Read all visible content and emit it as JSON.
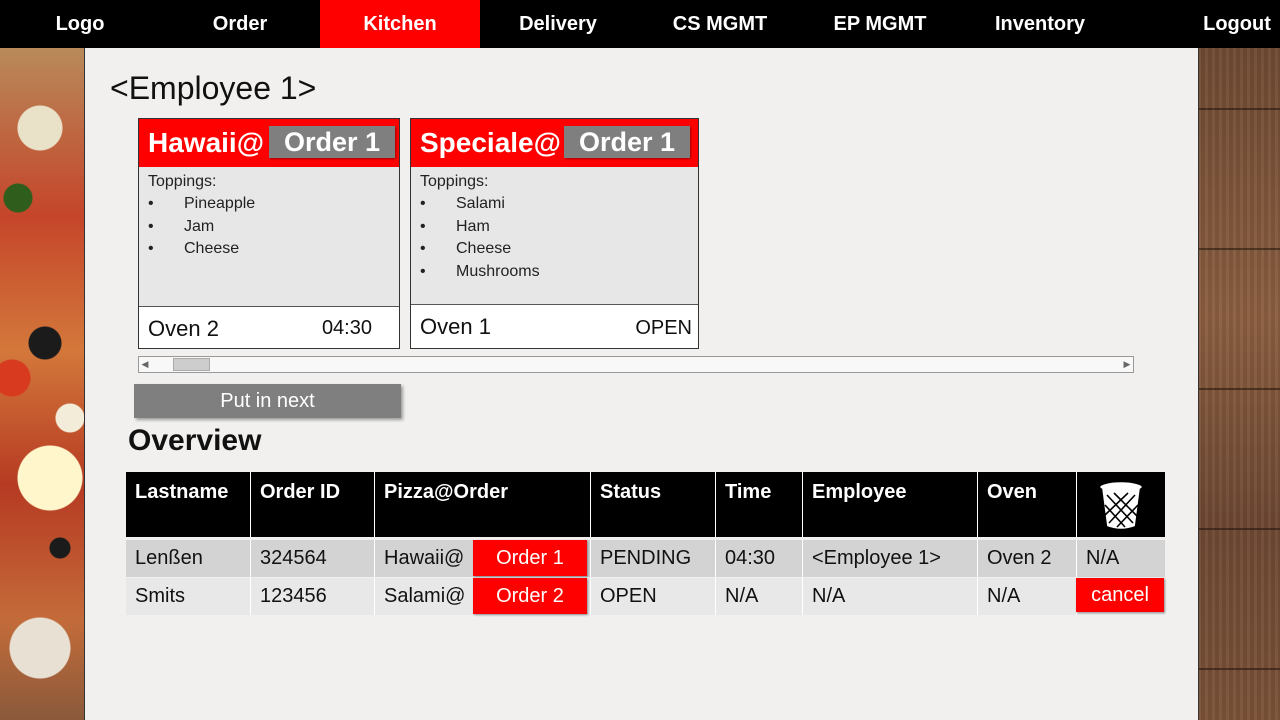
{
  "nav": {
    "items": [
      "Logo",
      "Order",
      "Kitchen",
      "Delivery",
      "CS MGMT",
      "EP MGMT",
      "Inventory",
      "Logout"
    ],
    "active": "Kitchen"
  },
  "employee_title": "<Employee 1>",
  "cards": [
    {
      "pizza": "Hawaii@",
      "order": "Order 1",
      "toppings_label": "Toppings:",
      "toppings": [
        "Pineapple",
        "Jam",
        "Cheese"
      ],
      "oven": "Oven 2",
      "status": "04:30"
    },
    {
      "pizza": "Speciale@",
      "order": "Order 1",
      "toppings_label": "Toppings:",
      "toppings": [
        "Salami",
        "Ham",
        "Cheese",
        "Mushrooms"
      ],
      "oven": "Oven 1",
      "status": "OPEN"
    }
  ],
  "put_next_label": "Put in next",
  "overview_title": "Overview",
  "table": {
    "headers": [
      "Lastname",
      "Order ID",
      "Pizza@Order",
      "Status",
      "Time",
      "Employee",
      "Oven"
    ],
    "trash_icon": "trash-icon",
    "rows": [
      {
        "lastname": "Lenßen",
        "order_id": "324564",
        "pizza": "Hawaii@",
        "order": "Order 1",
        "status": "PENDING",
        "time": "04:30",
        "employee": "<Employee 1>",
        "oven": "Oven 2",
        "action": "N/A"
      },
      {
        "lastname": "Smits",
        "order_id": "123456",
        "pizza": "Salami@",
        "order": "Order 2",
        "status": "OPEN",
        "time": "N/A",
        "employee": "N/A",
        "oven": "N/A",
        "action": "cancel"
      }
    ]
  },
  "colors": {
    "accent": "#ff0000",
    "nav_bg": "#000000",
    "button_gray": "#7f7f7f"
  }
}
